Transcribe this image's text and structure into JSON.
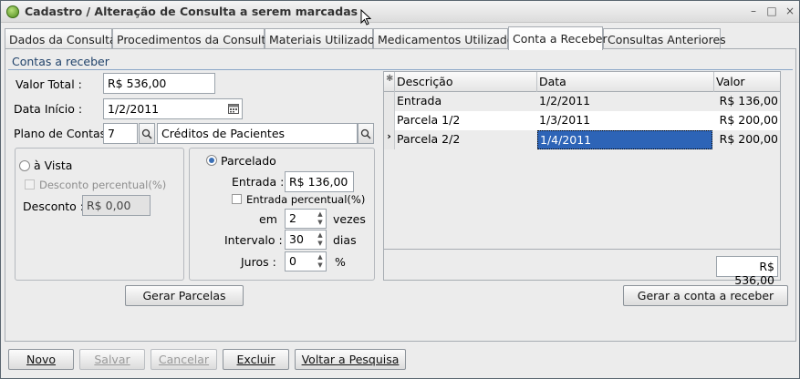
{
  "window": {
    "title": "Cadastro / Alteração de Consulta a serem marcadas",
    "controls": [
      "–",
      "□",
      "×"
    ]
  },
  "tabs": [
    {
      "label": "Dados da Consulta",
      "active": false
    },
    {
      "label": "Procedimentos da Consulta",
      "active": false
    },
    {
      "label": "Materiais Utilizados",
      "active": false
    },
    {
      "label": "Medicamentos Utilizados",
      "active": false
    },
    {
      "label": "Conta a Receber",
      "active": true
    },
    {
      "label": "Consultas Anteriores",
      "active": false
    }
  ],
  "section_title": "Contas a receber",
  "form": {
    "valor_total_label": "Valor Total :",
    "valor_total": "R$ 536,00",
    "data_inicio_label": "Data Início :",
    "data_inicio": "1/2/2011",
    "plano_label": "Plano de Contas:",
    "plano_code": "7",
    "plano_name": "Créditos de Pacientes",
    "a_vista_label": "à Vista",
    "desconto_pct_label": "Desconto percentual(%)",
    "desconto_label": "Desconto :",
    "desconto": "R$ 0,00",
    "parcelado_label": "Parcelado",
    "entrada_label": "Entrada :",
    "entrada": "R$ 136,00",
    "entrada_pct_label": "Entrada percentual(%)",
    "em_label": "em",
    "vezes": "2",
    "vezes_label": "vezes",
    "intervalo_label": "Intervalo :",
    "intervalo": "30",
    "dias_label": "dias",
    "juros_label": "Juros :",
    "juros": "0",
    "juros_unit": "%",
    "gerar_parcelas": "Gerar Parcelas"
  },
  "grid": {
    "headers": [
      "Descrição",
      "Data",
      "Valor"
    ],
    "rows": [
      {
        "descricao": "Entrada",
        "data": "1/2/2011",
        "valor": "R$ 136,00"
      },
      {
        "descricao": "Parcela 1/2",
        "data": "1/3/2011",
        "valor": "R$ 200,00"
      },
      {
        "descricao": "Parcela 2/2",
        "data": "1/4/2011",
        "valor": "R$ 200,00"
      }
    ],
    "total": "R$ 536,00",
    "selected_row": 2
  },
  "gerar_conta_button": "Gerar a conta a receber",
  "bottom_buttons": {
    "novo": "Novo",
    "salvar": "Salvar",
    "cancelar": "Cancelar",
    "excluir": "Excluir",
    "voltar": "Voltar a Pesquisa"
  }
}
